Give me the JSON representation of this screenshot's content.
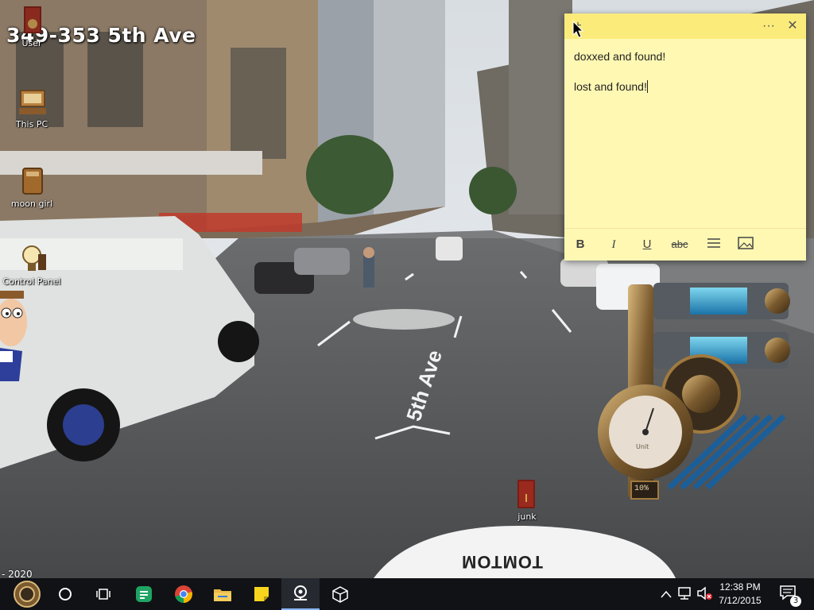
{
  "wallpaper": {
    "title": "349-353 5th Ave",
    "street_label": "5th Ave",
    "year_text": "- 2020",
    "vehicle_text": "TOMTOM"
  },
  "desktop": {
    "icons": [
      {
        "label": "User",
        "icon": "book-icon"
      },
      {
        "label": "This PC",
        "icon": "computer-icon"
      },
      {
        "label": "moon girl",
        "icon": "folder-icon"
      },
      {
        "label": "Control Panel",
        "icon": "lightbulb-icon"
      },
      {
        "label": "junk",
        "icon": "recycle-bin-icon"
      }
    ]
  },
  "sticky_note": {
    "lines": [
      "doxxed and found!",
      "lost and found!"
    ],
    "menu_glyph": "···",
    "close_glyph": "✕",
    "toolbar": {
      "bold": "B",
      "italic": "I",
      "underline": "U",
      "strike": "abc"
    },
    "color": "#fff8b3"
  },
  "gadget": {
    "gauge_label": "Unit",
    "gauge_value_text": "10%"
  },
  "taskbar": {
    "time": "12:38 PM",
    "date": "7/12/2015",
    "notification_count": "3",
    "items": [
      "start",
      "search",
      "task-view",
      "sheets",
      "chrome",
      "file-explorer",
      "sticky-notes",
      "maps",
      "unity"
    ]
  }
}
